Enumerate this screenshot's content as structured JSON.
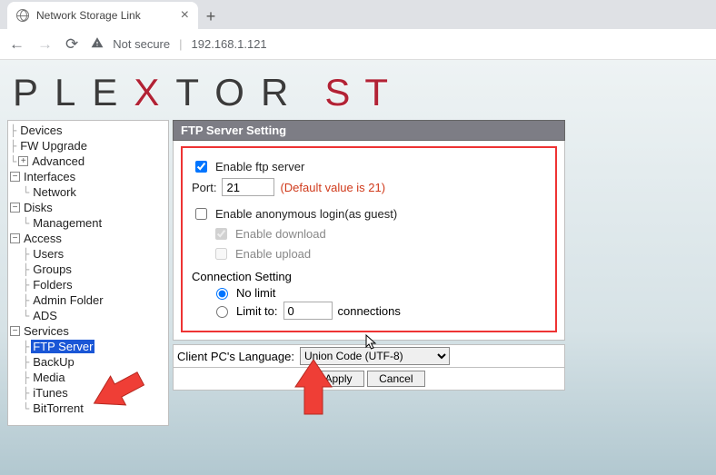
{
  "browser": {
    "tab_title": "Network Storage Link",
    "not_secure": "Not secure",
    "url": "192.168.1.121"
  },
  "logo": {
    "part1": "PLE",
    "x": "X",
    "part2": "TOR",
    "second": "ST"
  },
  "sidebar": {
    "items": [
      {
        "label": "Devices",
        "leaf": true
      },
      {
        "label": "FW Upgrade",
        "leaf": true
      },
      {
        "label": "Advanced",
        "leaf": true,
        "plus": true
      }
    ],
    "interfaces": {
      "label": "Interfaces",
      "children": [
        "Network"
      ]
    },
    "disks": {
      "label": "Disks",
      "children": [
        "Management"
      ]
    },
    "access": {
      "label": "Access",
      "children": [
        "Users",
        "Groups",
        "Folders",
        "Admin Folder",
        "ADS"
      ]
    },
    "services": {
      "label": "Services",
      "children": [
        "FTP Server",
        "BackUp",
        "Media",
        "iTunes",
        "BitTorrent"
      ],
      "selected": "FTP Server"
    }
  },
  "panel": {
    "title": "FTP Server Setting",
    "enable_ftp": "Enable ftp server",
    "port_label": "Port:",
    "port_value": "21",
    "port_note": "(Default value is 21)",
    "anon_label": "Enable anonymous login(as guest)",
    "anon_download": "Enable download",
    "anon_upload": "Enable upload",
    "conn_title": "Connection Setting",
    "conn_nolimit": "No limit",
    "conn_limit_prefix": "Limit to:",
    "conn_limit_value": "0",
    "conn_limit_suffix": "connections",
    "lang_label": "Client PC's Language:",
    "lang_value": "Union Code (UTF-8)",
    "apply": "Apply",
    "cancel": "Cancel"
  }
}
